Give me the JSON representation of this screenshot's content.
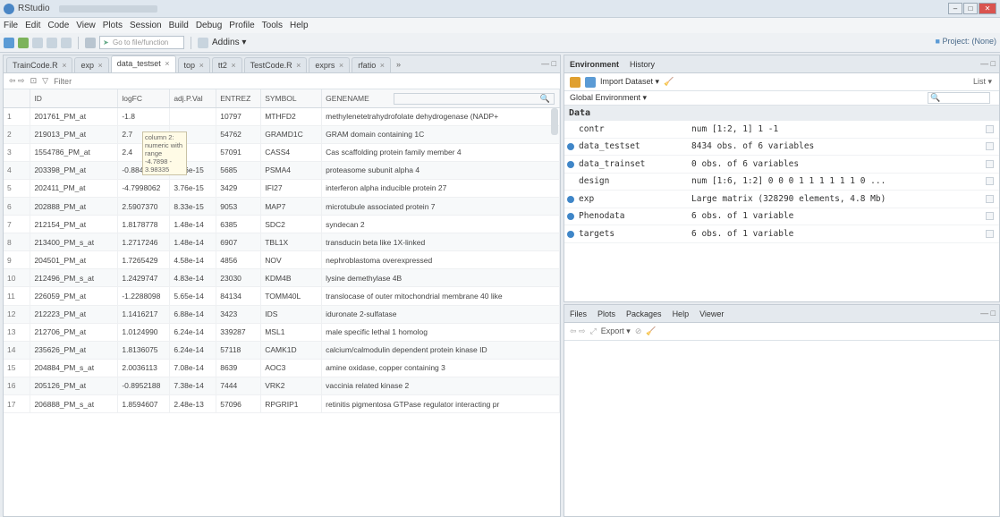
{
  "window": {
    "title": "RStudio"
  },
  "menu": [
    "File",
    "Edit",
    "Code",
    "View",
    "Plots",
    "Session",
    "Build",
    "Debug",
    "Profile",
    "Tools",
    "Help"
  ],
  "toolbar": {
    "goto_placeholder": "Go to file/function",
    "addins_label": "Addins ▾",
    "project_label": "Project: (None)"
  },
  "editor": {
    "tabs": [
      {
        "label": "TrainCode.R",
        "active": false
      },
      {
        "label": "exp",
        "active": false
      },
      {
        "label": "data_testset",
        "active": true
      },
      {
        "label": "top",
        "active": false
      },
      {
        "label": "tt2",
        "active": false
      },
      {
        "label": "TestCode.R",
        "active": false
      },
      {
        "label": "exprs",
        "active": false
      },
      {
        "label": "rfatio",
        "active": false
      }
    ],
    "tabs_more": "»",
    "filter_label": "Filter",
    "search_icon": "🔍",
    "tooltip": "column 2: numeric with range -4.7898 - 3.98335",
    "columns": [
      "ID",
      "logFC",
      "adj.P.Val",
      "ENTREZ",
      "SYMBOL",
      "GENENAME"
    ],
    "rows": [
      [
        "1",
        "201761_PM_at",
        "-1.8",
        "",
        "10797",
        "MTHFD2",
        "methylenetetrahydrofolate dehydrogenase (NADP+"
      ],
      [
        "2",
        "219013_PM_at",
        "2.7",
        "",
        "54762",
        "GRAMD1C",
        "GRAM domain containing 1C"
      ],
      [
        "3",
        "1554786_PM_at",
        "2.4",
        "",
        "57091",
        "CASS4",
        "Cas scaffolding protein family member 4"
      ],
      [
        "4",
        "203398_PM_at",
        "-0.8843683",
        "3.76e-15",
        "5685",
        "PSMA4",
        "proteasome subunit alpha 4"
      ],
      [
        "5",
        "202411_PM_at",
        "-4.7998062",
        "3.76e-15",
        "3429",
        "IFI27",
        "interferon alpha inducible protein 27"
      ],
      [
        "6",
        "202888_PM_at",
        "2.5907370",
        "8.33e-15",
        "9053",
        "MAP7",
        "microtubule associated protein 7"
      ],
      [
        "7",
        "212154_PM_at",
        "1.8178778",
        "1.48e-14",
        "6385",
        "SDC2",
        "syndecan 2"
      ],
      [
        "8",
        "213400_PM_s_at",
        "1.2717246",
        "1.48e-14",
        "6907",
        "TBL1X",
        "transducin beta like 1X-linked"
      ],
      [
        "9",
        "204501_PM_at",
        "1.7265429",
        "4.58e-14",
        "4856",
        "NOV",
        "nephroblastoma overexpressed"
      ],
      [
        "10",
        "212496_PM_s_at",
        "1.2429747",
        "4.83e-14",
        "23030",
        "KDM4B",
        "lysine demethylase 4B"
      ],
      [
        "11",
        "226059_PM_at",
        "-1.2288098",
        "5.65e-14",
        "84134",
        "TOMM40L",
        "translocase of outer mitochondrial membrane 40 like"
      ],
      [
        "12",
        "212223_PM_at",
        "1.1416217",
        "6.88e-14",
        "3423",
        "IDS",
        "iduronate 2-sulfatase"
      ],
      [
        "13",
        "212706_PM_at",
        "1.0124990",
        "6.24e-14",
        "339287",
        "MSL1",
        "male specific lethal 1 homolog"
      ],
      [
        "14",
        "235626_PM_at",
        "1.8136075",
        "6.24e-14",
        "57118",
        "CAMK1D",
        "calcium/calmodulin dependent protein kinase ID"
      ],
      [
        "15",
        "204884_PM_s_at",
        "2.0036113",
        "7.08e-14",
        "8639",
        "AOC3",
        "amine oxidase, copper containing 3"
      ],
      [
        "16",
        "205126_PM_at",
        "-0.8952188",
        "7.38e-14",
        "7444",
        "VRK2",
        "vaccinia related kinase 2"
      ],
      [
        "17",
        "206888_PM_s_at",
        "1.8594607",
        "2.48e-13",
        "57096",
        "RPGRIP1",
        "retinitis pigmentosa GTPase regulator interacting pr"
      ]
    ]
  },
  "environment": {
    "tabs": [
      "Environment",
      "History"
    ],
    "import_label": "Import Dataset ▾",
    "list_label": "List ▾",
    "scope_label": "Global Environment ▾",
    "section": "Data",
    "items": [
      {
        "name": "contr",
        "value": "num [1:2, 1] 1 -1",
        "dot": false
      },
      {
        "name": "data_testset",
        "value": "8434 obs. of 6 variables",
        "dot": true
      },
      {
        "name": "data_trainset",
        "value": "0 obs. of 6 variables",
        "dot": true
      },
      {
        "name": "design",
        "value": "num [1:6, 1:2] 0 0 0 1 1 1 1 1 1 0 ...",
        "dot": false
      },
      {
        "name": "exp",
        "value": "Large matrix (328290 elements, 4.8 Mb)",
        "dot": true
      },
      {
        "name": "Phenodata",
        "value": "6 obs. of 1 variable",
        "dot": true
      },
      {
        "name": "targets",
        "value": "6 obs. of 1 variable",
        "dot": true
      }
    ]
  },
  "files": {
    "tabs": [
      "Files",
      "Plots",
      "Packages",
      "Help",
      "Viewer"
    ],
    "export_label": "Export ▾"
  },
  "colors": {
    "accent": "#3f86c8",
    "close": "#d9534f"
  }
}
